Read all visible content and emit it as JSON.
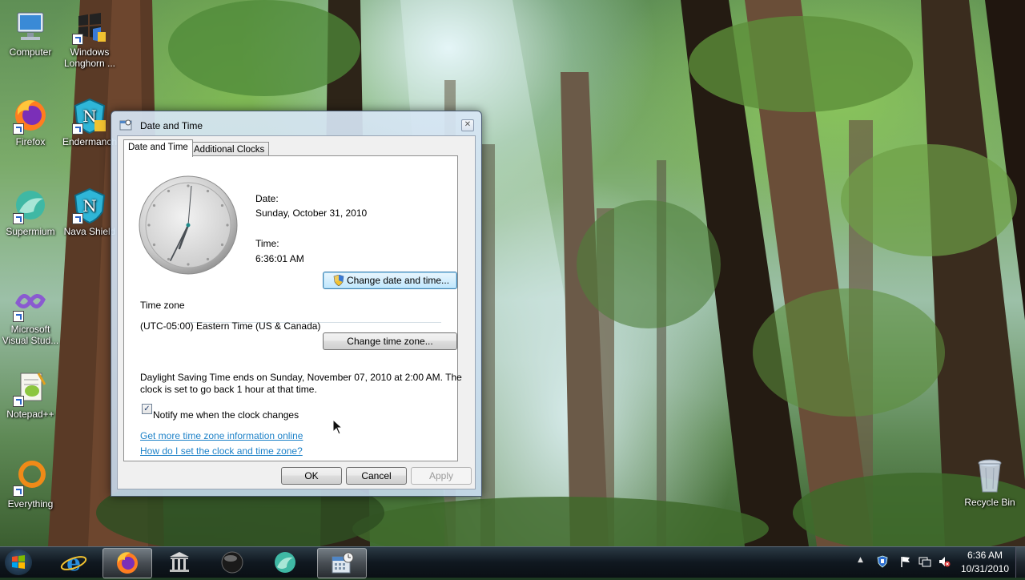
{
  "desktop": {
    "icons": [
      {
        "label": "Computer"
      },
      {
        "label": "Windows Longhorn ..."
      },
      {
        "label": "Firefox"
      },
      {
        "label": "Endermanch"
      },
      {
        "label": "Supermium"
      },
      {
        "label": "Nava Shield"
      },
      {
        "label": "Microsoft Visual Stud..."
      },
      {
        "label": "Notepad++"
      },
      {
        "label": "Everything"
      },
      {
        "label": "Recycle Bin"
      }
    ]
  },
  "dialog": {
    "title": "Date and Time",
    "close_glyph": "✕",
    "tabs": [
      {
        "label": "Date and Time",
        "selected": true
      },
      {
        "label": "Additional Clocks",
        "selected": false
      }
    ],
    "date_label": "Date:",
    "date_value": "Sunday, October 31, 2010",
    "time_label": "Time:",
    "time_value": "6:36:01 AM",
    "change_datetime_button": "Change date and time...",
    "timezone_heading": "Time zone",
    "timezone_value": "(UTC-05:00) Eastern Time (US & Canada)",
    "change_timezone_button": "Change time zone...",
    "dst_line1": "Daylight Saving Time ends on Sunday, November 07, 2010 at 2:00 AM. The",
    "dst_line2": "clock is set to go back 1 hour at that time.",
    "notify_checkbox_label": "Notify me when the clock changes",
    "notify_checked": true,
    "checkmark": "✓",
    "link_more_info": "Get more time zone information online",
    "link_help": "How do I set the clock and time zone?",
    "ok_button": "OK",
    "cancel_button": "Cancel",
    "apply_button": "Apply"
  },
  "taskbar": {
    "buttons": [
      "start",
      "internet-explorer",
      "firefox",
      "library",
      "media-orb",
      "supermium",
      "date-and-time"
    ],
    "tray_arrow": "▲",
    "clock_time": "6:36 AM",
    "clock_date": "10/31/2010"
  },
  "colors": {
    "link": "#1e82c8",
    "taskbar": "#101820"
  }
}
